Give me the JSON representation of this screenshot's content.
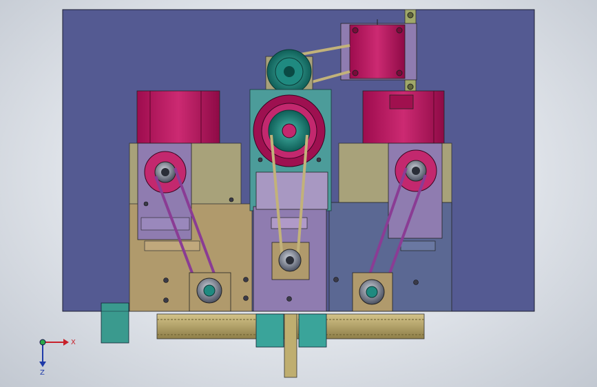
{
  "viewport": {
    "background_top": "#f4f6f9",
    "background_edge": "#c2c8d1"
  },
  "triad": {
    "x_label": "X",
    "z_label": "Z",
    "x_color": "#c8202a",
    "y_color": "#2aa84a",
    "z_color": "#1e3aa8"
  },
  "colors": {
    "base_plate": "#545a92",
    "motor_magenta": "#b2105a",
    "motor_face": "#c3286e",
    "tan_plate": "#b09a6c",
    "khaki_plate": "#a8a27a",
    "lavender_plate": "#8f7cb0",
    "steel_blue_plate": "#5b6893",
    "teal_housing": "#4c9c9a",
    "teal_pulley": "#1f8a80",
    "belt_purple": "#8a3c94",
    "belt_tan": "#c2b27a",
    "gear_tan": "#bfae70",
    "olive_strip": "#a0a86a",
    "cyan_block": "#3aa49a"
  }
}
